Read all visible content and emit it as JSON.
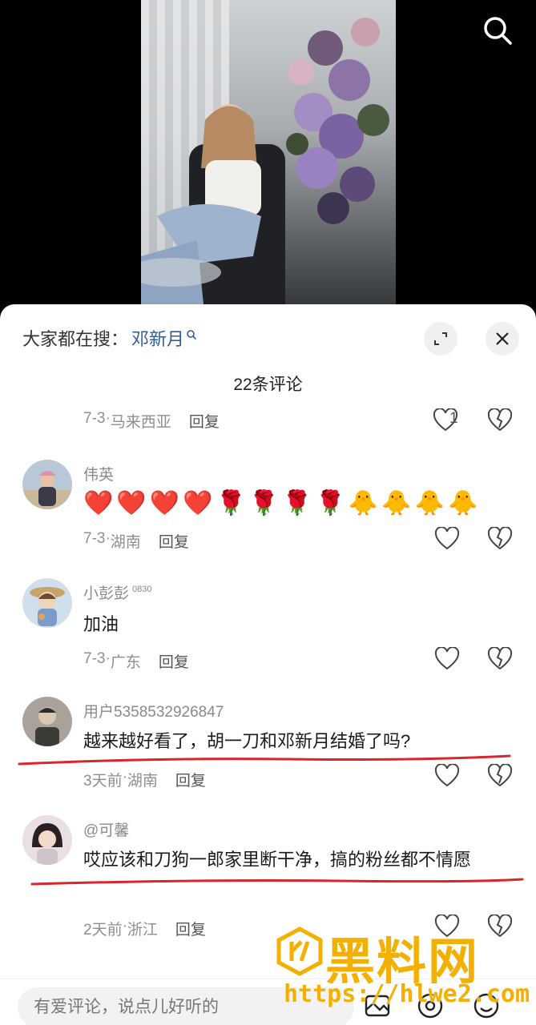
{
  "hot_search": {
    "prefix": "大家都在搜：",
    "keyword": "邓新月"
  },
  "comment_count_title": "22条评论",
  "comments": [
    {
      "user": "",
      "text": "",
      "date": "7-3",
      "location": "马来西亚",
      "reply": "回复",
      "likes": "1"
    },
    {
      "user": "伟英",
      "text": "",
      "emojis": [
        "❤️",
        "❤️",
        "❤️",
        "❤️",
        "🌹",
        "🌹",
        "🌹",
        "🌹",
        "🐥",
        "🐥",
        "🐥",
        "🐥"
      ],
      "date": "7-3",
      "location": "湖南",
      "reply": "回复"
    },
    {
      "user": "小彭彭",
      "user_sup": "0830",
      "text": "加油",
      "date": "7-3",
      "location": "广东",
      "reply": "回复"
    },
    {
      "user": "用户5358532926847",
      "text": "越来越好看了，胡一刀和邓新月结婚了吗?",
      "date": "3天前",
      "location": "湖南",
      "reply": "回复"
    },
    {
      "user": "@可馨",
      "text": "哎应该和刀狗一郎家里断干净，搞的粉丝都不情愿",
      "date": "2天前",
      "location": "浙江",
      "reply": "回复"
    }
  ],
  "input_placeholder": "有爱评论，说点儿好听的",
  "watermark": {
    "title": "黑料网",
    "url": "https://hlwe2.com"
  },
  "colors": {
    "keyword": "#2f5c9a",
    "watermark": "#f4b000",
    "annotation_line": "#d9262c"
  }
}
